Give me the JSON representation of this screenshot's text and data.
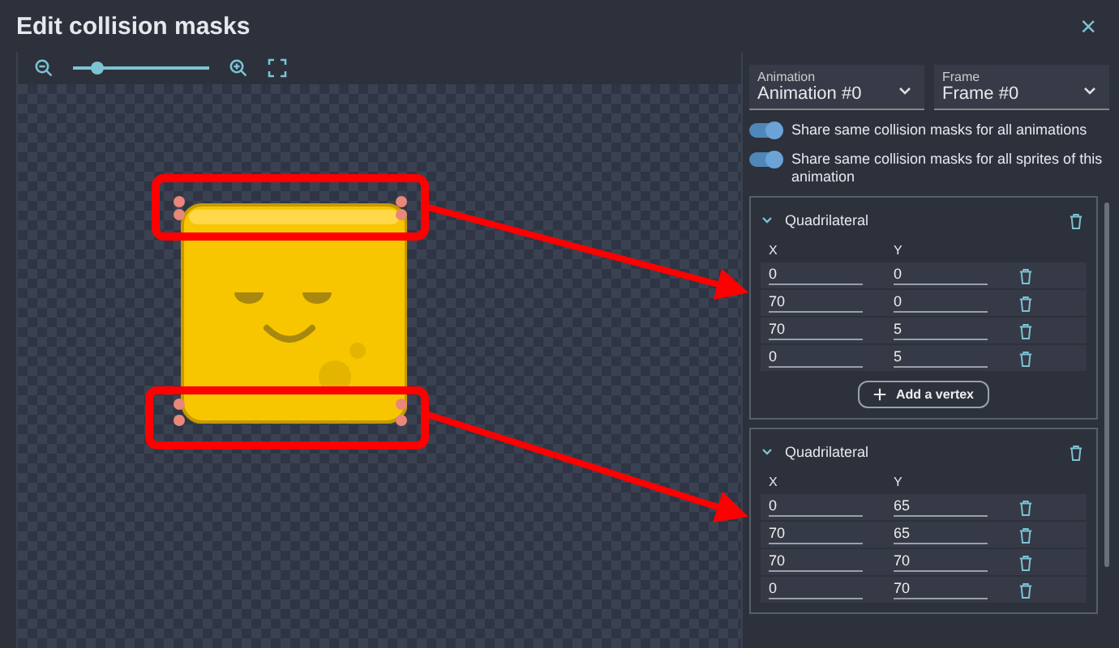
{
  "window": {
    "title": "Edit collision masks",
    "close": "×"
  },
  "zoom": {
    "level": 0.18
  },
  "selectors": [
    {
      "label": "Animation",
      "value": "Animation #0"
    },
    {
      "label": "Frame",
      "value": "Frame #0"
    }
  ],
  "toggles": [
    {
      "label": "Share same collision masks for all animations",
      "on": true
    },
    {
      "label": "Share same collision masks for all sprites of this animation",
      "on": true
    }
  ],
  "polygons": [
    {
      "title": "Quadrilateral",
      "expanded": true,
      "columns": [
        "X",
        "Y"
      ],
      "vertices": [
        [
          "0",
          "0"
        ],
        [
          "70",
          "0"
        ],
        [
          "70",
          "5"
        ],
        [
          "0",
          "5"
        ]
      ],
      "add_button": "Add a vertex"
    },
    {
      "title": "Quadrilateral",
      "expanded": true,
      "columns": [
        "X",
        "Y"
      ],
      "vertices": [
        [
          "0",
          "65"
        ],
        [
          "70",
          "65"
        ],
        [
          "70",
          "70"
        ],
        [
          "0",
          "70"
        ]
      ]
    }
  ]
}
